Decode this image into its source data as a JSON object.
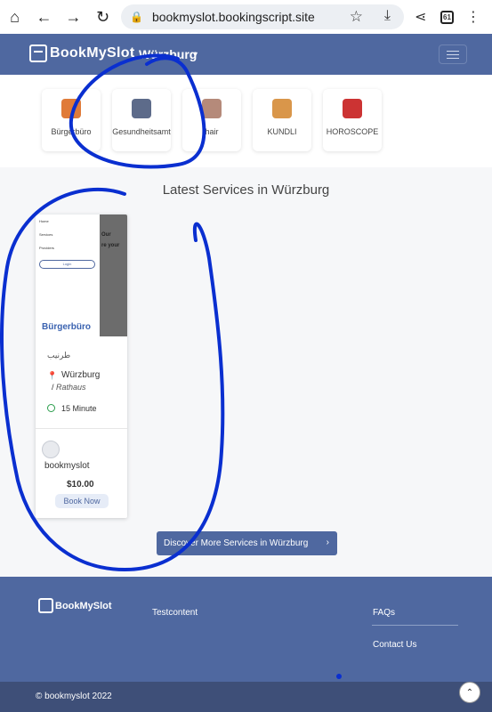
{
  "browser": {
    "url": "bookmyslot.bookingscript.site",
    "tab_count": "61"
  },
  "navbar": {
    "logo_text": "BookMySlot",
    "city": "Würzburg"
  },
  "categories": [
    {
      "label": "Bürgerbüro",
      "color": "#e07b39"
    },
    {
      "label": "Gesundheitsamt",
      "color": "#5d6b8a"
    },
    {
      "label": "hair",
      "color": "#b58a7a"
    },
    {
      "label": "KUNDLI",
      "color": "#d9964a"
    },
    {
      "label": "HOROSCOPE",
      "color": "#c33"
    }
  ],
  "section": {
    "title": "Latest Services in Würzburg"
  },
  "service_card": {
    "thumb_menu": [
      "Home",
      "Services",
      "Providers"
    ],
    "thumb_login": "Login",
    "thumb_dark_texts": [
      "Our",
      "re your"
    ],
    "name": "Bürgerbüro",
    "arabic_label": "طرنيب",
    "location": "Würzburg",
    "location_sub": "Rathaus",
    "duration": "15 Minute",
    "provider": "bookmyslot",
    "price": "$10.00",
    "book_label": "Book Now"
  },
  "discover_button": "Discover More Services in Würzburg",
  "footer": {
    "logo_text": "BookMySlot",
    "link_testcontent": "Testcontent",
    "link_faqs": "FAQs",
    "link_contact": "Contact Us",
    "copyright": "© bookmyslot 2022"
  }
}
